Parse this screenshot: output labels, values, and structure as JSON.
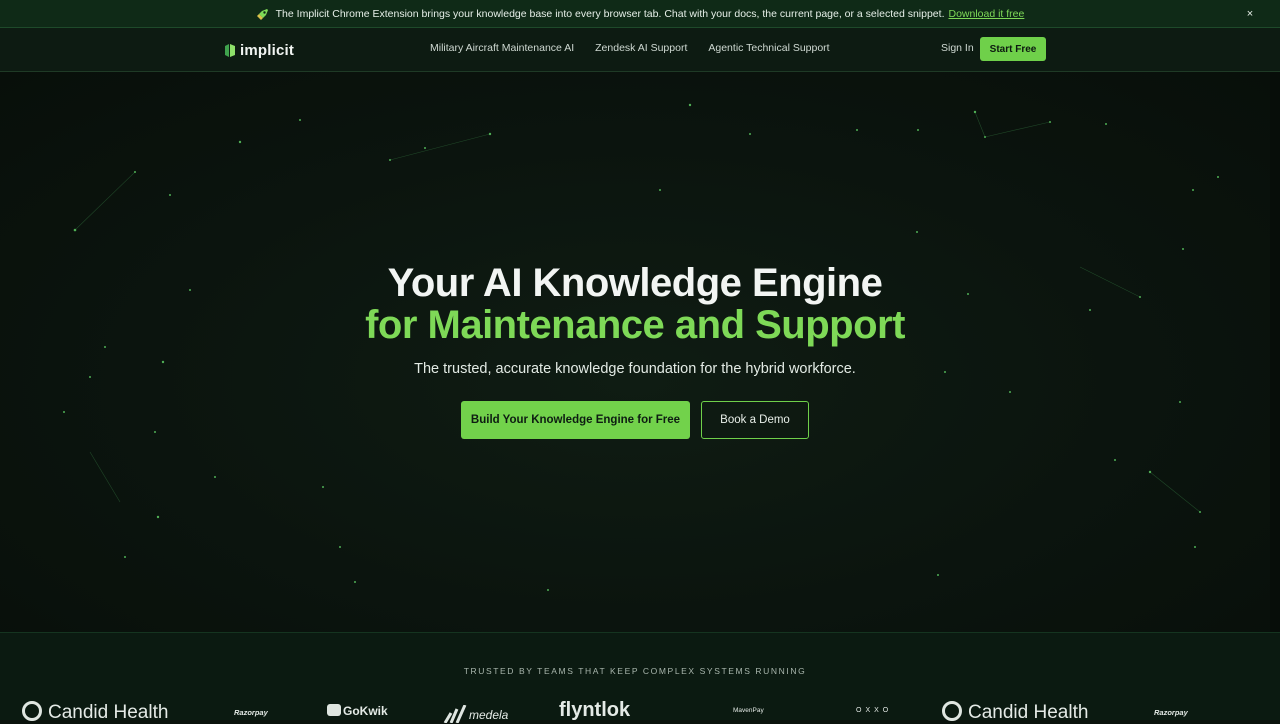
{
  "announcement": {
    "text": "The Implicit Chrome Extension brings your knowledge base into every browser tab. Chat with your docs, the current page, or a selected snippet.",
    "link": "Download it free",
    "close": "×"
  },
  "nav": {
    "logo": "implicit",
    "links": [
      "Military Aircraft Maintenance AI",
      "Zendesk AI Support",
      "Agentic Technical Support"
    ],
    "sign_in": "Sign In",
    "start_free": "Start Free"
  },
  "hero": {
    "title_line1": "Your AI Knowledge Engine",
    "title_line2": "for Maintenance and Support",
    "subtitle": "The trusted, accurate knowledge foundation for the hybrid workforce.",
    "primary_cta": "Build Your Knowledge Engine for Free",
    "secondary_cta": "Book a Demo"
  },
  "trusted": {
    "label": "TRUSTED BY TEAMS THAT KEEP COMPLEX SYSTEMS RUNNING",
    "logos": [
      "Candid Health",
      "Razorpay",
      "GoKwik",
      "medela",
      "flyntlok",
      "MavenPay",
      "OXXO",
      "Candid Health",
      "Razorpay"
    ]
  },
  "colors": {
    "accent": "#72d24b",
    "background": "#0a120c",
    "announcement_bg": "#0f2a17"
  }
}
